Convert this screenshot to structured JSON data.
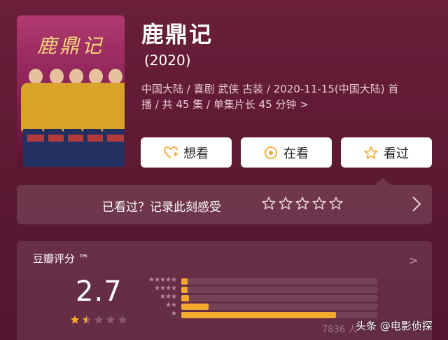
{
  "poster": {
    "calligraphy": "鹿鼎记"
  },
  "movie": {
    "title": "鹿鼎记",
    "year": "(2020)",
    "meta_line1": "中国大陆 / 喜剧 武侠 古装 / 2020-11-15(中国大陆) 首",
    "meta_line2": "播 / 共 45 集 / 单集片长 45 分钟",
    "meta_chevron": ">"
  },
  "actions": [
    {
      "label": "想看",
      "icon": "heart-plus-icon"
    },
    {
      "label": "在看",
      "icon": "target-circle-icon"
    },
    {
      "label": "看过",
      "icon": "star-outline-icon"
    }
  ],
  "watched_prompt": {
    "label": "已看过？记录此刻感受",
    "stars": 5
  },
  "rating": {
    "title": "豆瓣评分 ™",
    "score": "2.7",
    "score_stars": 1.5,
    "distribution": [
      {
        "stars": 5,
        "label": "★★★★★",
        "fraction": 0.03
      },
      {
        "stars": 4,
        "label": "★★★★",
        "fraction": 0.03
      },
      {
        "stars": 3,
        "label": "★★★",
        "fraction": 0.04
      },
      {
        "stars": 2,
        "label": "★★",
        "fraction": 0.14
      },
      {
        "stars": 1,
        "label": "★",
        "fraction": 0.79
      }
    ],
    "count": "7836 人"
  },
  "watermark": "头条 @电影侦探",
  "colors": {
    "accent_bar": "#f4a82c",
    "star_filled": "#f4a82c",
    "background": "#5e1a33"
  }
}
